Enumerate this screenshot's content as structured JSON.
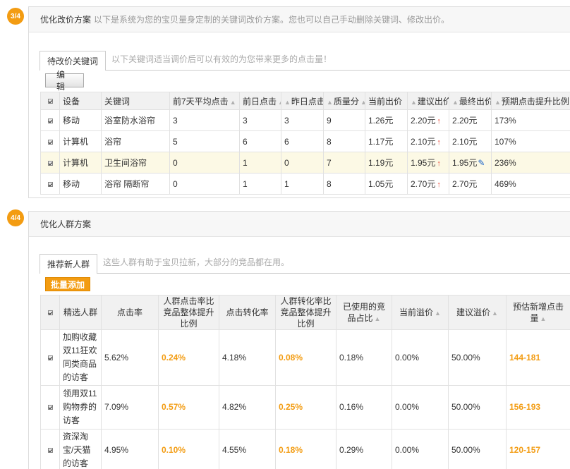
{
  "step3": {
    "badge": "3/4",
    "title": "优化改价方案",
    "desc": "以下是系统为您的宝贝量身定制的关键词改价方案。您也可以自己手动删除关键词、修改出价。",
    "tab_label": "待改价关键词",
    "tab_hint": "以下关键词适当调价后可以有效的为您带来更多的点击量！",
    "edit_label": "编辑",
    "headers": [
      "设备",
      "关键词",
      "前7天平均点击",
      "前日点击",
      "昨日点击",
      "质量分",
      "当前出价",
      "建议出价",
      "最终出价",
      "预期点击提升比例"
    ],
    "rows": [
      {
        "device": "移动",
        "keyword": "浴室防水浴帘",
        "avg7": "3",
        "prev": "3",
        "yest": "3",
        "quality": "9",
        "current": "1.26元",
        "suggest": "2.20元",
        "final": "2.20元",
        "lift": "173%"
      },
      {
        "device": "计算机",
        "keyword": "浴帘",
        "avg7": "5",
        "prev": "6",
        "yest": "6",
        "quality": "8",
        "current": "1.17元",
        "suggest": "2.10元",
        "final": "2.10元",
        "lift": "107%"
      },
      {
        "device": "计算机",
        "keyword": "卫生间浴帘",
        "avg7": "0",
        "prev": "1",
        "yest": "0",
        "quality": "7",
        "current": "1.19元",
        "suggest": "1.95元",
        "final": "1.95元",
        "lift": "236%"
      },
      {
        "device": "移动",
        "keyword": "浴帘 隔断帘",
        "avg7": "0",
        "prev": "1",
        "yest": "1",
        "quality": "8",
        "current": "1.05元",
        "suggest": "2.70元",
        "final": "2.70元",
        "lift": "469%"
      }
    ]
  },
  "step4": {
    "badge": "4/4",
    "title": "优化人群方案",
    "tab_label": "推荐新人群",
    "tab_hint": "这些人群有助于宝贝拉新，大部分的竞品都在用。",
    "batch_label": "批量添加",
    "headers": {
      "group": "精选人群",
      "ctr": "点击率",
      "ctr_lift": "人群点击率比竞品整体提升比例",
      "cvr": "点击转化率",
      "cvr_lift": "人群转化率比竞品整体提升比例",
      "share": "已使用的竞品占比",
      "cur_premium": "当前溢价",
      "sug_premium": "建议溢价",
      "est_clicks": "预估新增点击量"
    },
    "rows": [
      {
        "group": "加购收藏双11狂欢同类商品的访客",
        "ctr": "5.62%",
        "ctr_lift": "0.24%",
        "cvr": "4.18%",
        "cvr_lift": "0.08%",
        "share": "0.18%",
        "cur": "0.00%",
        "sug": "50.00%",
        "est": "144-181"
      },
      {
        "group": "领用双11购物券的访客",
        "ctr": "7.09%",
        "ctr_lift": "0.57%",
        "cvr": "4.82%",
        "cvr_lift": "0.25%",
        "share": "0.16%",
        "cur": "0.00%",
        "sug": "50.00%",
        "est": "156-193"
      },
      {
        "group": "资深淘宝/天猫的访客",
        "ctr": "4.95%",
        "ctr_lift": "0.10%",
        "cvr": "4.55%",
        "cvr_lift": "0.18%",
        "share": "0.29%",
        "cur": "0.00%",
        "sug": "50.00%",
        "est": "120-157"
      }
    ]
  },
  "colors": {
    "accent": "#f39c12",
    "up_arrow": "#e74c3c",
    "highlight_row": "#fcf9e5",
    "pencil": "#1a63c9"
  },
  "icons": [
    "checkbox-checked-icon",
    "sort-arrow-icon",
    "up-arrow-icon",
    "pencil-icon"
  ]
}
